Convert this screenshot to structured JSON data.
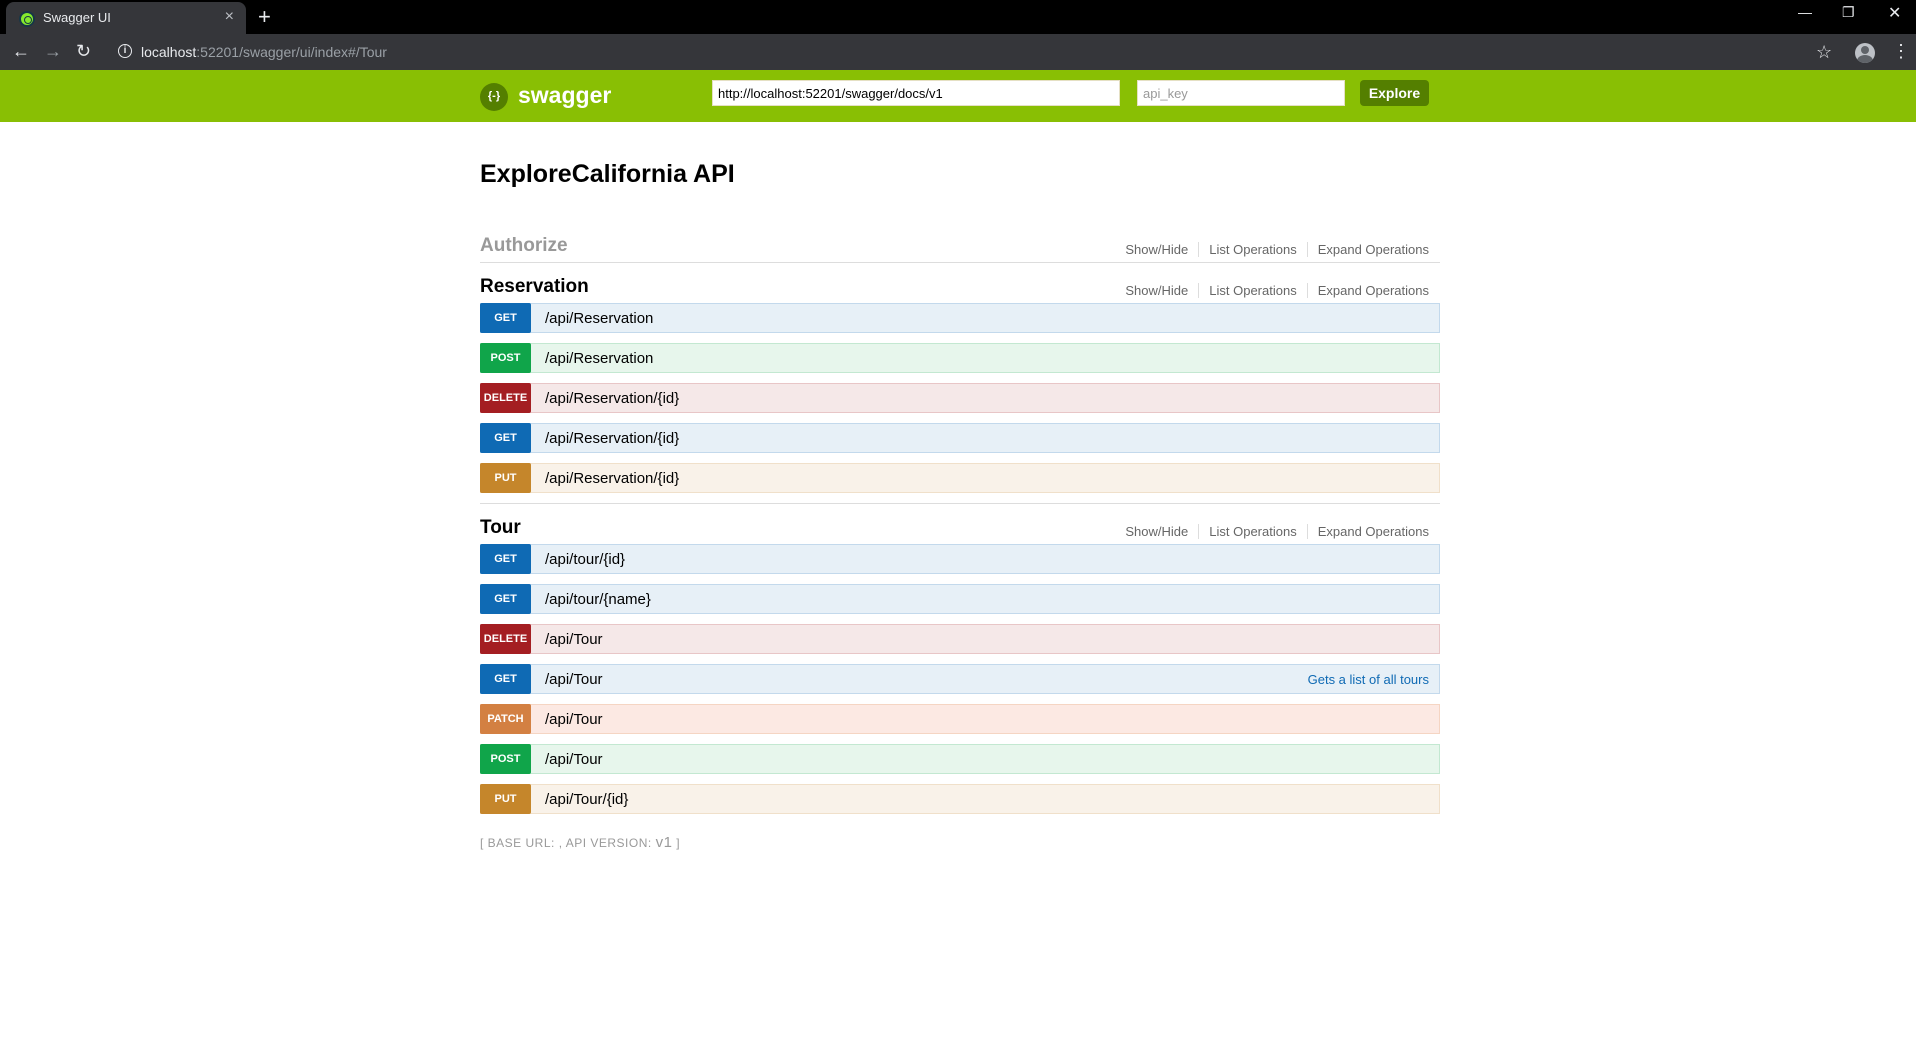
{
  "browser": {
    "tab_title": "Swagger UI",
    "tab_close": "×",
    "new_tab": "+",
    "url_host": "localhost",
    "url_rest": ":52201/swagger/ui/index#/Tour",
    "icons": [
      "back-icon",
      "forward-icon",
      "reload-icon",
      "info-icon",
      "star-icon",
      "profile-icon",
      "menu-icon"
    ]
  },
  "header": {
    "logo_glyph": "{-}",
    "brand": "swagger",
    "spec_url": "http://localhost:52201/swagger/docs/v1",
    "api_key_placeholder": "api_key",
    "explore_label": "Explore",
    "brand_color": "#89bf04"
  },
  "api": {
    "title": "ExploreCalifornia API"
  },
  "actions": {
    "show_hide": "Show/Hide",
    "list_operations": "List Operations",
    "expand_operations": "Expand Operations"
  },
  "resources": [
    {
      "name": "Authorize",
      "operations": []
    },
    {
      "name": "Reservation",
      "operations": [
        {
          "method": "GET",
          "path": "/api/Reservation",
          "summary": ""
        },
        {
          "method": "POST",
          "path": "/api/Reservation",
          "summary": ""
        },
        {
          "method": "DELETE",
          "path": "/api/Reservation/{id}",
          "summary": ""
        },
        {
          "method": "GET",
          "path": "/api/Reservation/{id}",
          "summary": ""
        },
        {
          "method": "PUT",
          "path": "/api/Reservation/{id}",
          "summary": ""
        }
      ]
    },
    {
      "name": "Tour",
      "operations": [
        {
          "method": "GET",
          "path": "/api/tour/{id}",
          "summary": ""
        },
        {
          "method": "GET",
          "path": "/api/tour/{name}",
          "summary": ""
        },
        {
          "method": "DELETE",
          "path": "/api/Tour",
          "summary": ""
        },
        {
          "method": "GET",
          "path": "/api/Tour",
          "summary": "Gets a list of all tours"
        },
        {
          "method": "PATCH",
          "path": "/api/Tour",
          "summary": ""
        },
        {
          "method": "POST",
          "path": "/api/Tour",
          "summary": ""
        },
        {
          "method": "PUT",
          "path": "/api/Tour/{id}",
          "summary": ""
        }
      ]
    }
  ],
  "footer": {
    "prefix": "[ BASE URL: , API VERSION: ",
    "version": "v1",
    "suffix": " ]"
  }
}
